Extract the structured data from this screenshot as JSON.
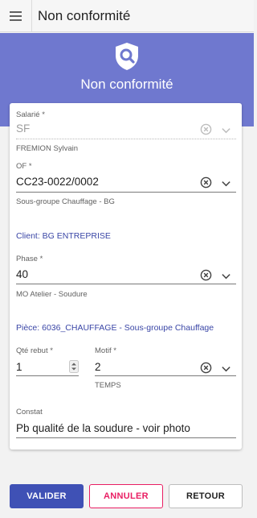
{
  "header": {
    "title": "Non conformité"
  },
  "hero": {
    "title": "Non conformité"
  },
  "form": {
    "salarie": {
      "label": "Salarié *",
      "value": "SF",
      "hint": "FREMION Sylvain"
    },
    "of": {
      "label": "OF *",
      "value": "CC23-0022/0002",
      "hint": "Sous-groupe Chauffage - BG"
    },
    "client": {
      "text": "Client: BG ENTREPRISE"
    },
    "phase": {
      "label": "Phase *",
      "value": "40",
      "hint": "MO Atelier - Soudure"
    },
    "piece": {
      "text": "Pièce: 6036_CHAUFFAGE - Sous-groupe Chauffage"
    },
    "qte_rebut": {
      "label": "Qté rebut *",
      "value": "1"
    },
    "motif": {
      "label": "Motif *",
      "value": "2",
      "hint": "TEMPS"
    },
    "constat": {
      "label": "Constat",
      "value": "Pb qualité de la soudure - voir photo"
    }
  },
  "actions": {
    "validate": "VALIDER",
    "cancel": "ANNULER",
    "back": "RETOUR"
  },
  "colors": {
    "primary": "#3f51b5",
    "hero": "#6f78cf",
    "danger": "#e91e63",
    "info_text": "#3a46a6"
  },
  "icons": {
    "menu": "menu-icon",
    "hero": "shield-search-icon",
    "clear": "clear-circle-icon",
    "dropdown": "chevron-down-icon",
    "stepper": "stepper-icon"
  }
}
